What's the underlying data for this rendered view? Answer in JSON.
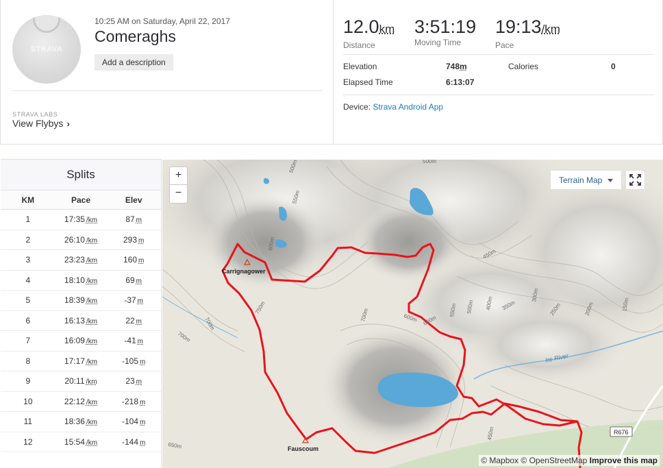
{
  "activity": {
    "datetime": "10:25 AM on Saturday, April 22, 2017",
    "name": "Comeraghs",
    "add_description": "Add a description",
    "avatar_logo": "STRAVA"
  },
  "labs": {
    "title": "STRAVA LABS",
    "link": "View Flybys"
  },
  "stats": {
    "distance": {
      "value": "12.0",
      "unit": "km",
      "label": "Distance"
    },
    "moving_time": {
      "value": "3:51:19",
      "label": "Moving Time"
    },
    "pace": {
      "value": "19:13",
      "unit": "/km",
      "label": "Pace"
    }
  },
  "details": {
    "elevation_label": "Elevation",
    "elevation_value": "748",
    "elevation_unit": "m",
    "calories_label": "Calories",
    "calories_value": "0",
    "elapsed_label": "Elapsed Time",
    "elapsed_value": "6:13:07",
    "device_label": "Device:",
    "device_value": "Strava Android App"
  },
  "splits": {
    "title": "Splits",
    "headers": [
      "KM",
      "Pace",
      "Elev"
    ],
    "pace_unit": "/km",
    "elev_unit": "m",
    "rows": [
      {
        "km": "1",
        "pace": "17:35",
        "elev": "87"
      },
      {
        "km": "2",
        "pace": "26:10",
        "elev": "293"
      },
      {
        "km": "3",
        "pace": "23:23",
        "elev": "160"
      },
      {
        "km": "4",
        "pace": "18:10",
        "elev": "69"
      },
      {
        "km": "5",
        "pace": "18:39",
        "elev": "-37"
      },
      {
        "km": "6",
        "pace": "16:13",
        "elev": "22"
      },
      {
        "km": "7",
        "pace": "16:09",
        "elev": "-41"
      },
      {
        "km": "8",
        "pace": "17:17",
        "elev": "-105"
      },
      {
        "km": "9",
        "pace": "20:11",
        "elev": "23"
      },
      {
        "km": "10",
        "pace": "22:12",
        "elev": "-218"
      },
      {
        "km": "11",
        "pace": "18:36",
        "elev": "-104"
      },
      {
        "km": "12",
        "pace": "15:54",
        "elev": "-144"
      }
    ]
  },
  "map": {
    "zoom_in": "+",
    "zoom_out": "−",
    "terrain_label": "Terrain Map",
    "places": {
      "carrignagower": "Carrignagower",
      "fauscoum": "Fauscoum",
      "river": "Ire River",
      "road": "R676"
    },
    "contours": [
      "500m",
      "550m",
      "600m",
      "650m",
      "700m",
      "700m",
      "750m",
      "700m",
      "600m",
      "650m",
      "600m",
      "550m",
      "500m",
      "450m",
      "400m",
      "350m",
      "300m",
      "250m",
      "200m",
      "150m",
      "450m",
      "650m",
      "500m",
      "450m",
      "400m"
    ],
    "attribution_mapbox": "© Mapbox",
    "attribution_osm": "© OpenStreetMap",
    "attribution_improve": "Improve this map",
    "route_color": "#e8141b",
    "water_color": "#5aa8d8"
  }
}
